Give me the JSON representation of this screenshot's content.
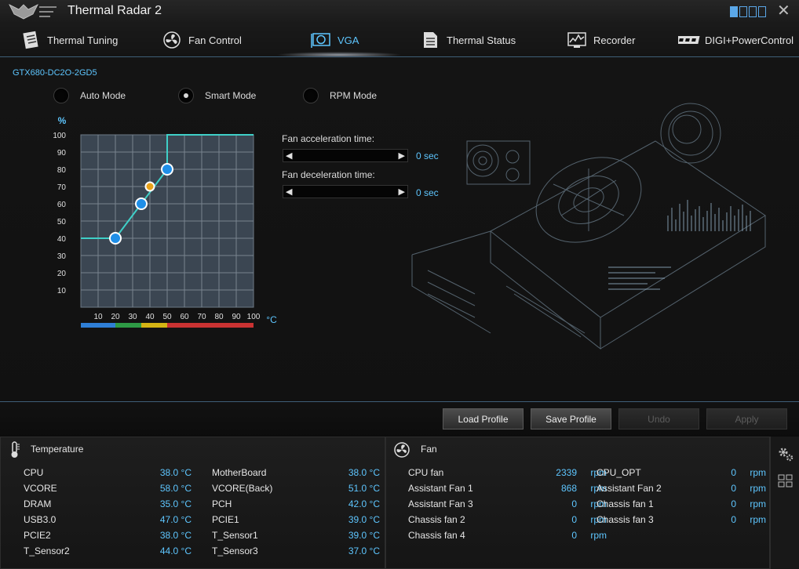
{
  "app": {
    "title": "Thermal Radar 2"
  },
  "tabs": [
    {
      "label": "Thermal Tuning",
      "icon": "document-icon"
    },
    {
      "label": "Fan Control",
      "icon": "fan-icon"
    },
    {
      "label": "VGA",
      "icon": "graphics-card-icon",
      "active": true
    },
    {
      "label": "Thermal Status",
      "icon": "list-icon"
    },
    {
      "label": "Recorder",
      "icon": "monitor-graph-icon"
    },
    {
      "label": "DIGI+PowerControl",
      "icon": "digi-logo-icon"
    }
  ],
  "vga": {
    "device": "GTX680-DC2O-2GD5",
    "modes": [
      {
        "label": "Auto Mode",
        "selected": false
      },
      {
        "label": "Smart Mode",
        "selected": true
      },
      {
        "label": "RPM Mode",
        "selected": false
      }
    ],
    "accel_label": "Fan acceleration time:",
    "accel_value": "0 sec",
    "decel_label": "Fan deceleration time:",
    "decel_value": "0 sec"
  },
  "chart_data": {
    "type": "line",
    "y_axis_label": "%",
    "x_axis_unit": "°C",
    "xlim": [
      0,
      100
    ],
    "ylim": [
      0,
      100
    ],
    "x_ticks": [
      "10",
      "20",
      "30",
      "40",
      "50",
      "60",
      "70",
      "80",
      "90",
      "100"
    ],
    "y_ticks": [
      "100",
      "90",
      "80",
      "70",
      "60",
      "50",
      "40",
      "30",
      "20",
      "10"
    ],
    "series": [
      {
        "points": [
          [
            0,
            40
          ],
          [
            20,
            40
          ],
          [
            35,
            60
          ],
          [
            50,
            80
          ],
          [
            50,
            100
          ],
          [
            100,
            100
          ]
        ]
      }
    ],
    "control_points": [
      [
        20,
        40
      ],
      [
        35,
        60
      ],
      [
        40,
        70
      ],
      [
        50,
        80
      ]
    ],
    "highlight_point": [
      40,
      70
    ],
    "zone_colors": [
      {
        "from": 0,
        "to": 20,
        "color": "#2f7fd6"
      },
      {
        "from": 20,
        "to": 35,
        "color": "#2e9a45"
      },
      {
        "from": 35,
        "to": 50,
        "color": "#d4b414"
      },
      {
        "from": 50,
        "to": 100,
        "color": "#c93232"
      }
    ]
  },
  "buttons": {
    "load": "Load Profile",
    "save": "Save Profile",
    "undo": "Undo",
    "apply": "Apply"
  },
  "temperature": {
    "title": "Temperature",
    "rows": [
      {
        "label": "CPU",
        "value": "38.0 °C"
      },
      {
        "label": "MotherBoard",
        "value": "38.0 °C"
      },
      {
        "label": "VCORE",
        "value": "58.0 °C"
      },
      {
        "label": "VCORE(Back)",
        "value": "51.0 °C"
      },
      {
        "label": "DRAM",
        "value": "35.0 °C"
      },
      {
        "label": "PCH",
        "value": "42.0 °C"
      },
      {
        "label": "USB3.0",
        "value": "47.0 °C"
      },
      {
        "label": "PCIE1",
        "value": "39.0 °C"
      },
      {
        "label": "PCIE2",
        "value": "38.0 °C"
      },
      {
        "label": "T_Sensor1",
        "value": "39.0 °C"
      },
      {
        "label": "T_Sensor2",
        "value": "44.0 °C"
      },
      {
        "label": "T_Sensor3",
        "value": "37.0 °C"
      }
    ]
  },
  "fan": {
    "title": "Fan",
    "unit": "rpm",
    "rows": [
      {
        "label": "CPU fan",
        "value": "2339"
      },
      {
        "label": "CPU_OPT",
        "value": "0"
      },
      {
        "label": "Assistant Fan 1",
        "value": "868"
      },
      {
        "label": "Assistant Fan 2",
        "value": "0"
      },
      {
        "label": "Assistant Fan 3",
        "value": "0"
      },
      {
        "label": "Chassis fan 1",
        "value": "0"
      },
      {
        "label": "Chassis fan 2",
        "value": "0"
      },
      {
        "label": "Chassis fan 3",
        "value": "0"
      },
      {
        "label": "Chassis fan 4",
        "value": "0"
      }
    ]
  },
  "colors": {
    "accent": "#5ec6ff",
    "curve": "#3fd0c8",
    "point": "#1f8fe8",
    "highlight": "#e8a21a"
  }
}
